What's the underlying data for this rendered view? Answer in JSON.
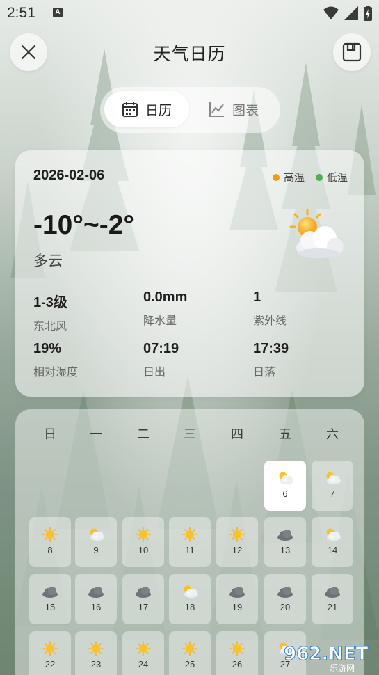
{
  "status_bar": {
    "time": "2:51",
    "badge": "A"
  },
  "header": {
    "title": "天气日历"
  },
  "tabs": [
    {
      "label": "日历",
      "icon": "calendar-icon",
      "active": true
    },
    {
      "label": "图表",
      "icon": "chart-icon",
      "active": false
    }
  ],
  "info": {
    "date": "2026-02-06",
    "legend": [
      {
        "label": "高温",
        "color": "#f39a12"
      },
      {
        "label": "低温",
        "color": "#4caf50"
      }
    ],
    "temperature": "-10°~-2°",
    "condition": "多云",
    "stats": [
      {
        "value": "1-3级",
        "label": "东北风"
      },
      {
        "value": "0.0mm",
        "label": "降水量"
      },
      {
        "value": "1",
        "label": "紫外线"
      },
      {
        "value": "19%",
        "label": "相对湿度"
      },
      {
        "value": "07:19",
        "label": "日出"
      },
      {
        "value": "17:39",
        "label": "日落"
      }
    ]
  },
  "calendar": {
    "weekdays": [
      "日",
      "一",
      "二",
      "三",
      "四",
      "五",
      "六"
    ],
    "days": [
      {
        "day": "6",
        "icon": "partly-cloudy-icon",
        "selected": true
      },
      {
        "day": "7",
        "icon": "partly-cloudy-icon"
      },
      {
        "day": "8",
        "icon": "sun-icon"
      },
      {
        "day": "9",
        "icon": "partly-cloudy-icon"
      },
      {
        "day": "10",
        "icon": "sun-icon"
      },
      {
        "day": "11",
        "icon": "sun-icon"
      },
      {
        "day": "12",
        "icon": "sun-icon"
      },
      {
        "day": "13",
        "icon": "cloud-icon"
      },
      {
        "day": "14",
        "icon": "partly-cloudy-icon"
      },
      {
        "day": "15",
        "icon": "cloud-icon"
      },
      {
        "day": "16",
        "icon": "cloud-icon"
      },
      {
        "day": "17",
        "icon": "cloud-icon"
      },
      {
        "day": "18",
        "icon": "partly-cloudy-icon"
      },
      {
        "day": "19",
        "icon": "cloud-icon"
      },
      {
        "day": "20",
        "icon": "cloud-icon"
      },
      {
        "day": "21",
        "icon": "cloud-icon"
      },
      {
        "day": "22",
        "icon": "sun-icon"
      },
      {
        "day": "23",
        "icon": "sun-icon"
      },
      {
        "day": "24",
        "icon": "sun-icon"
      },
      {
        "day": "25",
        "icon": "sun-icon"
      },
      {
        "day": "26",
        "icon": "sun-icon"
      },
      {
        "day": "27",
        "icon": "partly-cloudy-icon"
      }
    ]
  },
  "watermark": {
    "text": "962.NET",
    "sub": "乐游网"
  }
}
